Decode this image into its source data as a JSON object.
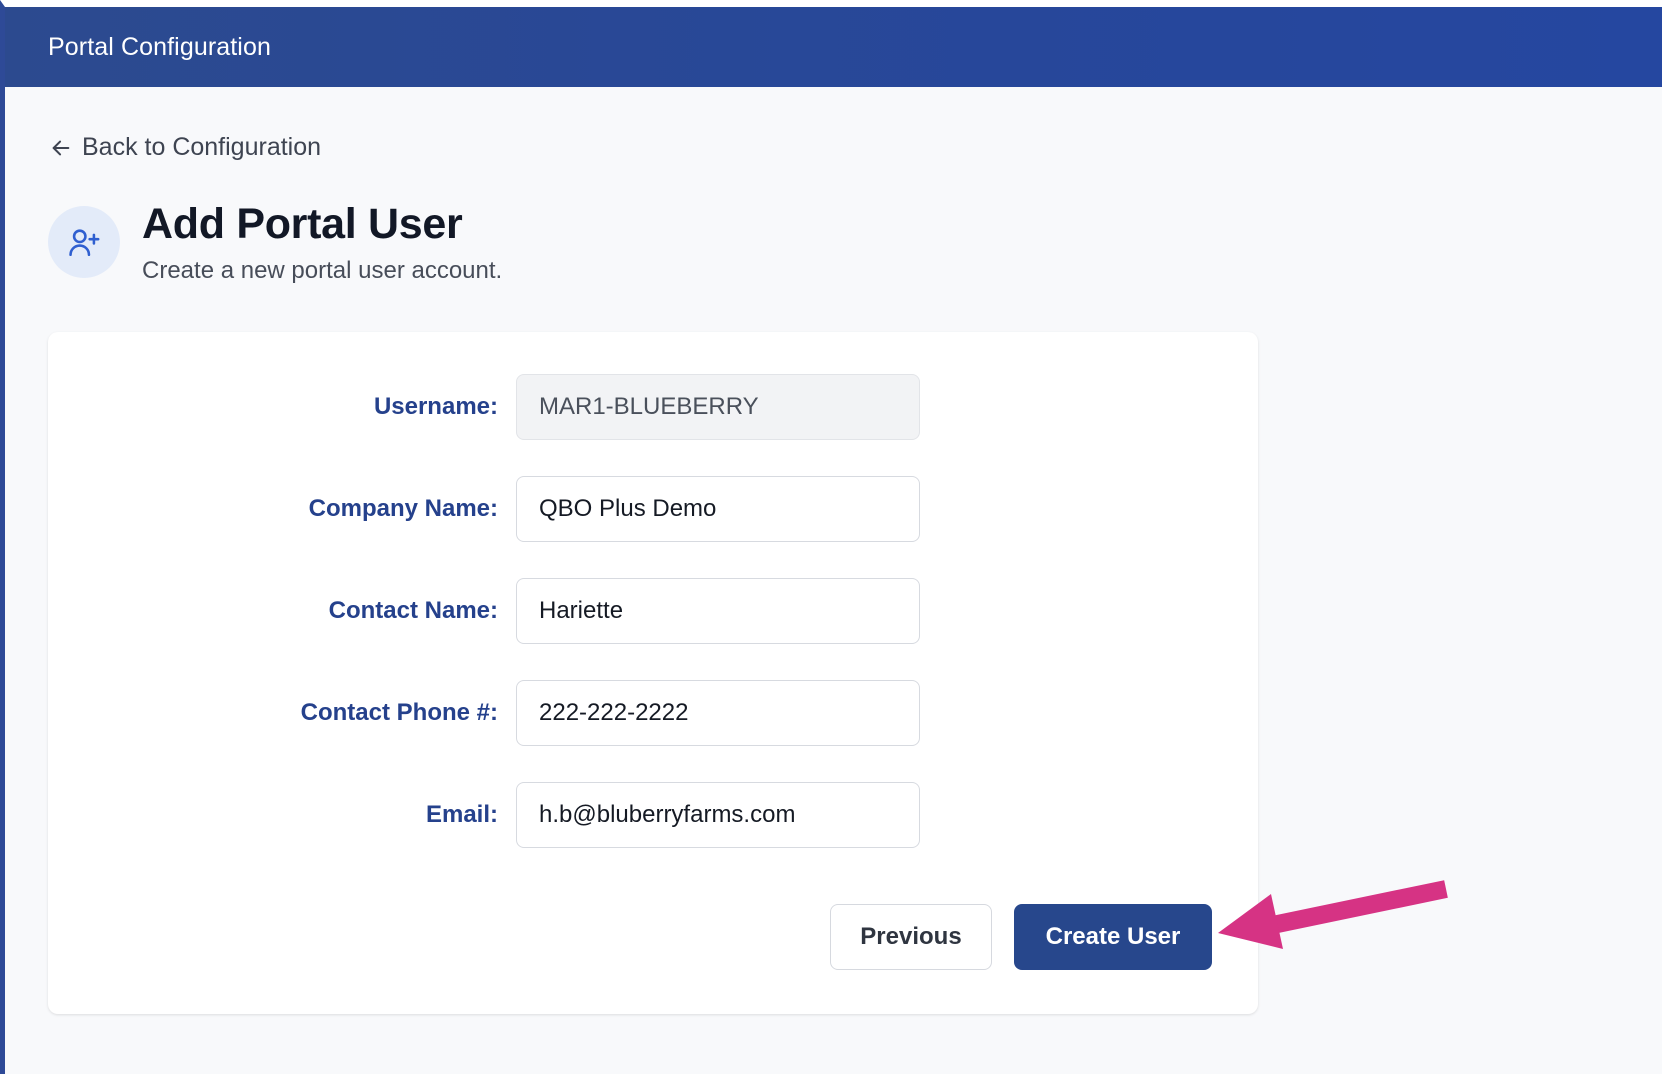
{
  "header": {
    "title": "Portal Configuration"
  },
  "nav": {
    "back_label": "Back to Configuration",
    "back_icon": "arrow-left-icon"
  },
  "page": {
    "icon": "user-plus-icon",
    "title": "Add Portal User",
    "subtitle": "Create a new portal user account."
  },
  "form": {
    "fields": [
      {
        "label": "Username:",
        "value": "MAR1-BLUEBERRY",
        "disabled": true
      },
      {
        "label": "Company Name:",
        "value": "QBO Plus Demo",
        "disabled": false
      },
      {
        "label": "Contact Name:",
        "value": "Hariette",
        "disabled": false
      },
      {
        "label": "Contact Phone #:",
        "value": "222-222-2222",
        "disabled": false
      },
      {
        "label": "Email:",
        "value": "h.b@bluberryfarms.com",
        "disabled": false
      }
    ],
    "previous_label": "Previous",
    "create_label": "Create User"
  },
  "annotation": {
    "icon": "pointer-arrow-icon",
    "color": "#d63384"
  },
  "colors": {
    "header_bg": "#27479a",
    "label": "#25418c",
    "primary_button": "#27478c"
  }
}
